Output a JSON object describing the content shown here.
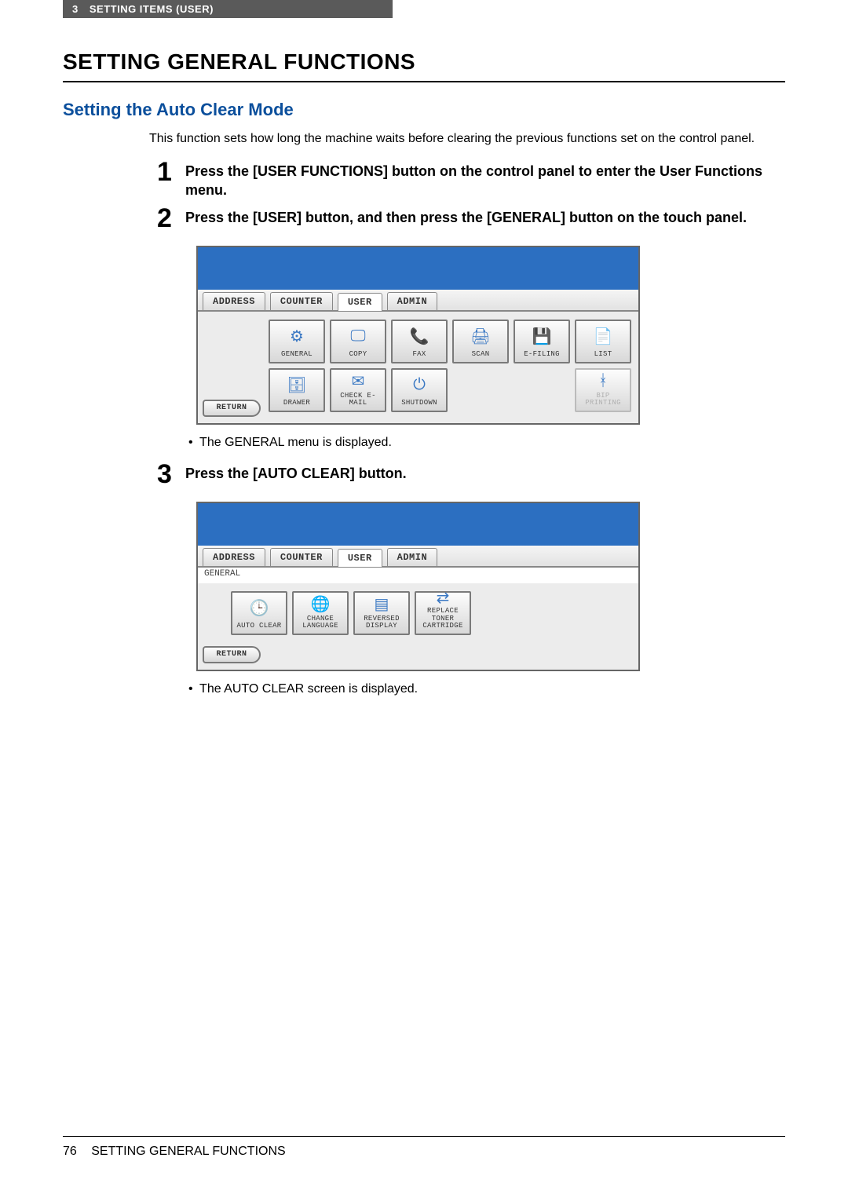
{
  "header": {
    "chapter_num": "3",
    "chapter_title": "SETTING ITEMS (USER)"
  },
  "h1": "SETTING GENERAL FUNCTIONS",
  "h2": "Setting the Auto Clear Mode",
  "intro": "This function sets how long the machine waits before clearing the previous functions set on the control panel.",
  "steps": {
    "s1": {
      "num": "1",
      "text": "Press the [USER FUNCTIONS] button on the control panel to enter the User Functions menu."
    },
    "s2": {
      "num": "2",
      "text": "Press the [USER] button, and then press the [GENERAL] button on the touch panel."
    },
    "s3": {
      "num": "3",
      "text": "Press the [AUTO CLEAR] button."
    }
  },
  "bullets": {
    "b1": "The GENERAL menu is displayed.",
    "b2": "The AUTO CLEAR screen is displayed."
  },
  "shot1": {
    "tabs": {
      "address": "ADDRESS",
      "counter": "COUNTER",
      "user": "USER",
      "admin": "ADMIN"
    },
    "row1": {
      "general": "GENERAL",
      "copy": "COPY",
      "fax": "FAX",
      "scan": "SCAN",
      "efiling": "E-FILING",
      "list": "LIST"
    },
    "row2": {
      "drawer": "DRAWER",
      "checkemail": "CHECK E-MAIL",
      "shutdown": "SHUTDOWN",
      "bip": "BIP PRINTING"
    },
    "return": "RETURN"
  },
  "shot2": {
    "tabs": {
      "address": "ADDRESS",
      "counter": "COUNTER",
      "user": "USER",
      "admin": "ADMIN"
    },
    "crumb": "GENERAL",
    "row": {
      "autoclear": "AUTO CLEAR",
      "changelang": "CHANGE\nLANGUAGE",
      "reversed": "REVERSED\nDISPLAY",
      "replace": "REPLACE\nTONER\nCARTRIDGE"
    },
    "return": "RETURN"
  },
  "footer": {
    "page": "76",
    "title": "SETTING GENERAL FUNCTIONS"
  }
}
